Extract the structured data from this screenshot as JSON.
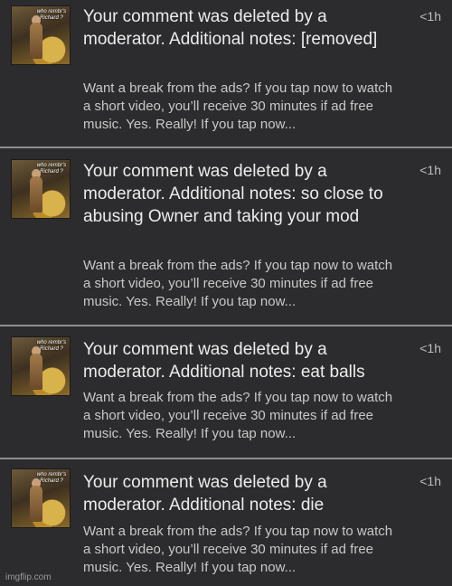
{
  "notifications": [
    {
      "avatar_caption": "who rembr's Richard ?",
      "title": "Your comment was deleted by a moderator. Additional notes: [removed]",
      "body": "Want a break from the ads? If you tap now to watch a short video, you’ll receive 30 minutes if ad free music. Yes. Really! If you tap now...",
      "time": "<1h"
    },
    {
      "avatar_caption": "who rembr's Richard ?",
      "title": "Your comment was deleted by a moderator. Additional notes: so close to abusing Owner and taking your mod",
      "body": "Want a break from the ads? If you tap now to watch a short video, you’ll receive 30 minutes if ad free music. Yes. Really! If you tap now...",
      "time": "<1h"
    },
    {
      "avatar_caption": "who rembr's Richard ?",
      "title": "Your comment was deleted by a moderator. Additional notes: eat balls",
      "body": "Want a break from the ads? If you tap now to watch a short video, you’ll receive 30 minutes if ad free music. Yes. Really! If you tap now...",
      "time": "<1h"
    },
    {
      "avatar_caption": "who rembr's Richard ?",
      "title": "Your comment was deleted by a moderator. Additional notes: die",
      "body": "Want a break from the ads? If you tap now to watch a short video, you’ll receive 30 minutes if ad free music. Yes. Really! If you tap now...",
      "time": "<1h"
    }
  ],
  "watermark": "imgflip.com"
}
